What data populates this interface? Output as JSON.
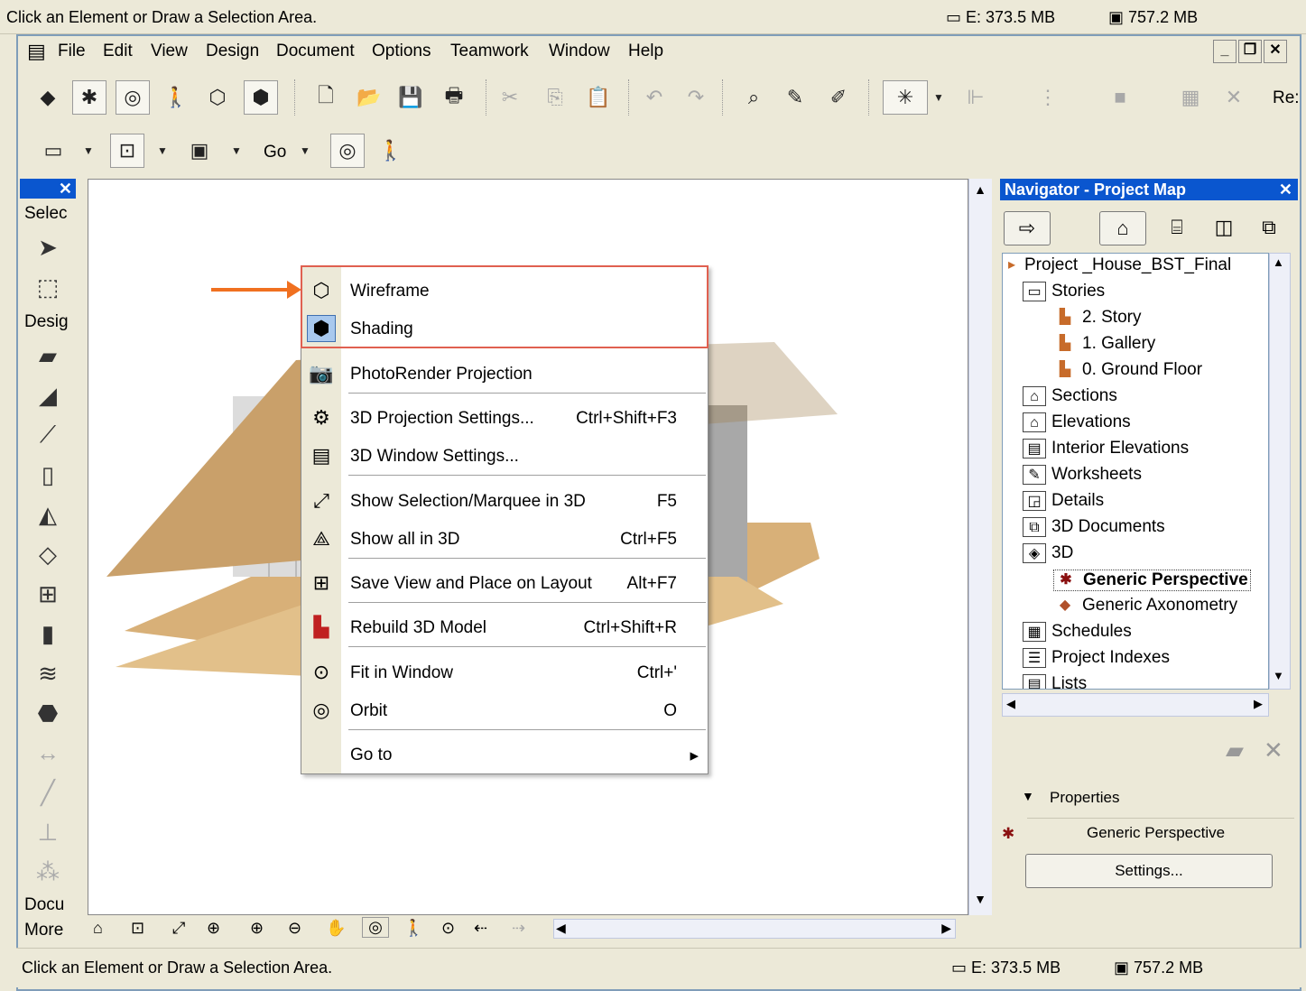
{
  "top_status": {
    "message": "Click an Element or Draw a Selection Area.",
    "disk": "E: 373.5 MB",
    "ram": "757.2 MB"
  },
  "menubar": {
    "items": [
      "File",
      "Edit",
      "View",
      "Design",
      "Document",
      "Options",
      "Teamwork",
      "Window",
      "Help"
    ]
  },
  "window_controls": {
    "minimize": "_",
    "restore": "❐",
    "close": "✕"
  },
  "toolbar2": {
    "go_label": "Go",
    "re_label": "Re:"
  },
  "toolbox": {
    "close": "✕",
    "selection_label": "Selec",
    "design_label": "Desig",
    "document_label": "Docu",
    "more_label": "More"
  },
  "context_menu": {
    "items": [
      {
        "label": "Wireframe",
        "shortcut": "",
        "icon": "wireframe-icon"
      },
      {
        "label": "Shading",
        "shortcut": "",
        "icon": "shading-icon"
      },
      {
        "label": "PhotoRender Projection",
        "shortcut": "",
        "icon": "camera-icon"
      },
      {
        "label": "3D Projection Settings...",
        "shortcut": "Ctrl+Shift+F3",
        "icon": "projection-settings-icon"
      },
      {
        "label": "3D Window Settings...",
        "shortcut": "",
        "icon": "window-settings-icon"
      },
      {
        "label": "Show Selection/Marquee in 3D",
        "shortcut": "F5",
        "icon": "show-selection-icon"
      },
      {
        "label": "Show all in 3D",
        "shortcut": "Ctrl+F5",
        "icon": "show-all-icon"
      },
      {
        "label": "Save View and Place on Layout",
        "shortcut": "Alt+F7",
        "icon": "save-view-icon"
      },
      {
        "label": "Rebuild 3D Model",
        "shortcut": "Ctrl+Shift+R",
        "icon": "rebuild-icon"
      },
      {
        "label": "Fit in Window",
        "shortcut": "Ctrl+'",
        "icon": "fit-window-icon"
      },
      {
        "label": "Orbit",
        "shortcut": "O",
        "icon": "orbit-icon"
      },
      {
        "label": "Go to",
        "shortcut": "▸",
        "icon": ""
      }
    ]
  },
  "navigator": {
    "title": "Navigator - Project Map",
    "close": "✕",
    "tree": [
      {
        "label": "Project _House_BST_Final",
        "bold": false
      },
      {
        "label": "Stories",
        "bold": false
      },
      {
        "label": "2. Story",
        "bold": false
      },
      {
        "label": "1. Gallery",
        "bold": false
      },
      {
        "label": "0. Ground Floor",
        "bold": false
      },
      {
        "label": "Sections",
        "bold": false
      },
      {
        "label": "Elevations",
        "bold": false
      },
      {
        "label": "Interior Elevations",
        "bold": false
      },
      {
        "label": "Worksheets",
        "bold": false
      },
      {
        "label": "Details",
        "bold": false
      },
      {
        "label": "3D Documents",
        "bold": false
      },
      {
        "label": "3D",
        "bold": false
      },
      {
        "label": "Generic Perspective",
        "bold": true
      },
      {
        "label": "Generic Axonometry",
        "bold": false
      },
      {
        "label": "Schedules",
        "bold": false
      },
      {
        "label": "Project Indexes",
        "bold": false
      },
      {
        "label": "Lists",
        "bold": false
      }
    ],
    "properties_label": "Properties",
    "properties_value": "Generic Perspective",
    "settings_button": "Settings..."
  },
  "bottom_status": {
    "message": "Click an Element or Draw a Selection Area.",
    "disk": "E: 373.5 MB",
    "ram": "757.2 MB"
  },
  "colors": {
    "accent": "#0a56cf",
    "highlight_border": "#e06050",
    "arrow": "#f07020",
    "roof": "#c9a06a"
  }
}
